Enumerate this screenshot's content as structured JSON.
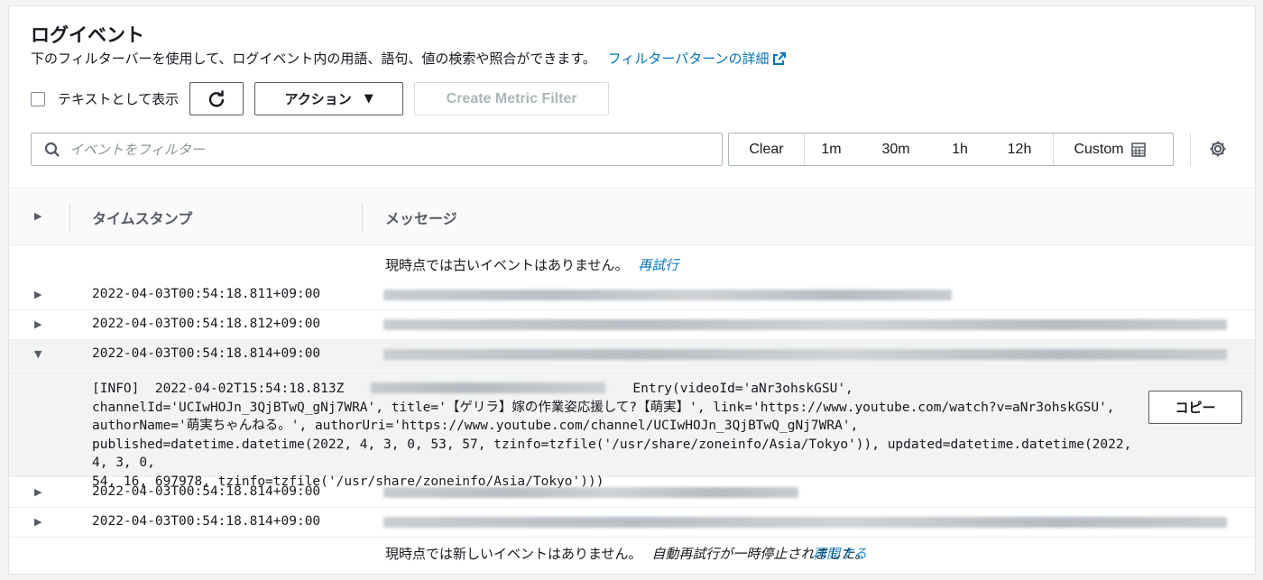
{
  "header": {
    "title": "ログイベント",
    "description": "下のフィルターバーを使用して、ログイベント内の用語、語句、値の検索や照合ができます。",
    "learn_more_link": "フィルターパターンの詳細"
  },
  "toolbar": {
    "view_as_text_label": "テキストとして表示",
    "view_as_text_checked": false,
    "actions_label": "アクション",
    "create_metric_filter_label": "Create Metric Filter"
  },
  "filter": {
    "placeholder": "イベントをフィルター",
    "time_options": [
      "Clear",
      "1m",
      "30m",
      "1h",
      "12h",
      "Custom"
    ]
  },
  "table": {
    "columns": [
      "タイムスタンプ",
      "メッセージ"
    ],
    "older_status": "現時点では古いイベントはありません。",
    "retry_link": "再試行",
    "rows": [
      {
        "timestamp": "2022-04-03T00:54:18.811+09:00",
        "expanded": false
      },
      {
        "timestamp": "2022-04-03T00:54:18.812+09:00",
        "expanded": false
      },
      {
        "timestamp": "2022-04-03T00:54:18.814+09:00",
        "expanded": true
      },
      {
        "timestamp": "2022-04-03T00:54:18.814+09:00",
        "expanded": false
      },
      {
        "timestamp": "2022-04-03T00:54:18.814+09:00",
        "expanded": false
      }
    ],
    "expanded_message": {
      "part1": "[INFO]\t2022-04-02T15:54:18.813Z",
      "part2": "Entry(videoId='aNr3ohskGSU',\nchannelId='UCIwHOJn_3QjBTwQ_gNj7WRA', title='【ゲリラ】嫁の作業姿応援して?【萌実】', link='https://www.youtube.com/watch?v=aNr3ohskGSU',\nauthorName='萌実ちゃんねる。', authorUri='https://www.youtube.com/channel/UCIwHOJn_3QjBTwQ_gNj7WRA',\npublished=datetime.datetime(2022, 4, 3, 0, 53, 57, tzinfo=tzfile('/usr/share/zoneinfo/Asia/Tokyo')), updated=datetime.datetime(2022, 4, 3, 0,\n54, 16, 697978, tzinfo=tzfile('/usr/share/zoneinfo/Asia/Tokyo')))",
      "copy_label": "コピー"
    },
    "newer_status": "現時点では新しいイベントはありません。",
    "newer_status_italic": "自動再試行が一時停止されました。",
    "resume_link": "再開する"
  }
}
